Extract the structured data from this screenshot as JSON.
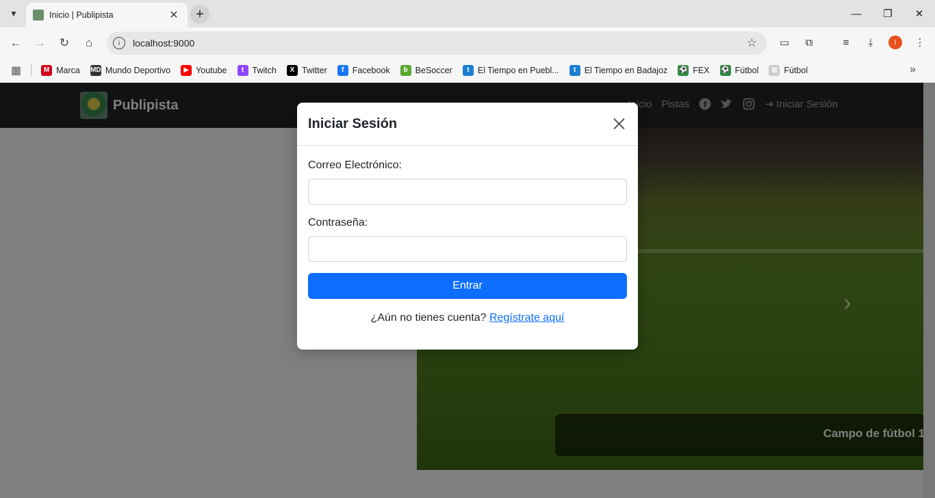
{
  "browser": {
    "tab_title": "Inicio | Publipista",
    "url": "localhost:9000",
    "profile_initial": "I",
    "bookmarks": [
      {
        "label": "Marca",
        "color": "#d0021b",
        "glyph": "M"
      },
      {
        "label": "Mundo Deportivo",
        "color": "#333333",
        "glyph": "MD"
      },
      {
        "label": "Youtube",
        "color": "#ff0000",
        "glyph": "▶"
      },
      {
        "label": "Twitch",
        "color": "#9146ff",
        "glyph": "t"
      },
      {
        "label": "Twitter",
        "color": "#000000",
        "glyph": "X"
      },
      {
        "label": "Facebook",
        "color": "#1877f2",
        "glyph": "f"
      },
      {
        "label": "BeSoccer",
        "color": "#5aa832",
        "glyph": "b"
      },
      {
        "label": "El Tiempo en Puebl...",
        "color": "#1a7fd4",
        "glyph": "t"
      },
      {
        "label": "El Tiempo en Badajoz",
        "color": "#1a7fd4",
        "glyph": "t"
      },
      {
        "label": "FEX",
        "color": "#2e8b3e",
        "glyph": "⚽"
      },
      {
        "label": "Fútbol",
        "color": "#2e8b3e",
        "glyph": "⚽"
      },
      {
        "label": "Fútbol",
        "color": "#cccccc",
        "glyph": "▦"
      }
    ]
  },
  "navbar": {
    "brand": "Publipista",
    "links": [
      "Inicio",
      "Pistas"
    ],
    "login": "Iniciar Sesión"
  },
  "hero": {
    "caption": "Campo de fútbol 1"
  },
  "modal": {
    "title": "Iniciar Sesión",
    "email_label": "Correo Electrónico:",
    "email_value": "",
    "password_label": "Contraseña:",
    "password_value": "",
    "submit_label": "Entrar",
    "register_prompt": "¿Aún no tienes cuenta?",
    "register_link": "Regístrate aquí"
  },
  "colors": {
    "primary": "#0d6efd",
    "navbar_bg": "#212529"
  }
}
